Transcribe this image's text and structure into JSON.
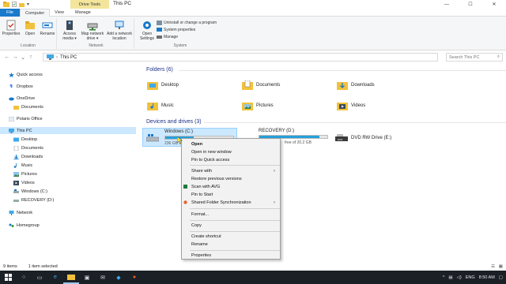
{
  "window": {
    "title": "This PC",
    "context_tab": "Drive Tools",
    "controls": [
      "—",
      "☐",
      "✕"
    ]
  },
  "ribbon_tabs": [
    {
      "label": "File"
    },
    {
      "label": "Computer"
    },
    {
      "label": "View"
    },
    {
      "label": "Manage"
    }
  ],
  "ribbon": {
    "location": {
      "name": "Location",
      "buttons": [
        "Properties",
        "Open",
        "Rename"
      ]
    },
    "network": {
      "name": "Network",
      "buttons": [
        "Access media ▾",
        "Map network drive ▾",
        "Add a network location"
      ]
    },
    "system": {
      "name": "System",
      "open_settings": "Open Settings",
      "small": [
        "Uninstall or change a program",
        "System properties",
        "Manage"
      ]
    }
  },
  "address": {
    "path": "This PC",
    "search_placeholder": "Search This PC"
  },
  "nav": {
    "items": [
      {
        "label": "Quick access"
      },
      {
        "label": "Dropbox"
      },
      {
        "label": "OneDrive"
      },
      {
        "label": "Documents"
      },
      {
        "label": "Polaris Office"
      },
      {
        "label": "This PC"
      },
      {
        "label": "Desktop"
      },
      {
        "label": "Documents"
      },
      {
        "label": "Downloads"
      },
      {
        "label": "Music"
      },
      {
        "label": "Pictures"
      },
      {
        "label": "Videos"
      },
      {
        "label": "Windows (C:)"
      },
      {
        "label": "RECOVERY (D:)"
      },
      {
        "label": "Network"
      },
      {
        "label": "Homegroup"
      }
    ]
  },
  "folders": {
    "header": "Folders (6)",
    "items": [
      {
        "label": "Desktop"
      },
      {
        "label": "Documents"
      },
      {
        "label": "Downloads"
      },
      {
        "label": "Music"
      },
      {
        "label": "Pictures"
      },
      {
        "label": "Videos"
      }
    ]
  },
  "devices": {
    "header": "Devices and drives (3)",
    "drives": [
      {
        "label": "Windows (C:)",
        "free_text": "236 GB",
        "used_fraction": 0.42
      },
      {
        "label": "RECOVERY (D:)",
        "free_text": "free of 20.2 GB",
        "used_fraction": 0.88
      },
      {
        "label": "DVD RW Drive (E:)"
      }
    ]
  },
  "context_menu": {
    "items": [
      "Open",
      "Open in new window",
      "Pin to Quick access",
      "Share with",
      "Restore previous versions",
      "Scan with AVG",
      "Pin to Start",
      "Shared Folder Synchronization",
      "Format...",
      "Copy",
      "Create shortcut",
      "Rename",
      "Properties"
    ]
  },
  "status": {
    "count": "9 items",
    "selected": "1 item selected"
  },
  "tray": {
    "lang": "ENG",
    "time": "8:50 AM"
  },
  "colors": {
    "accent": "#1979ca",
    "drive_bar": "#26a0da",
    "selection": "#cce8ff",
    "context_tab": "#f3e59b",
    "taskbar": "#1b1f26"
  }
}
